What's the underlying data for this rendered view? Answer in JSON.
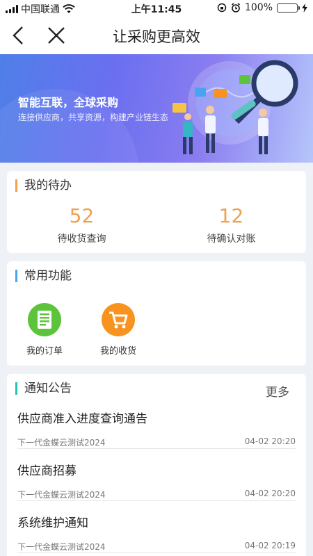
{
  "status": {
    "carrier": "中国联通",
    "time": "上午11:45",
    "battery": "100%"
  },
  "nav": {
    "title": "让采购更高效"
  },
  "banner": {
    "title": "智能互联，全球采购",
    "subtitle": "连接供应商，共享资源，构建产业链生态"
  },
  "todo": {
    "title": "我的待办",
    "items": [
      {
        "count": "52",
        "label": "待收货查询"
      },
      {
        "count": "12",
        "label": "待确认对账"
      }
    ]
  },
  "functions": {
    "title": "常用功能",
    "items": [
      {
        "label": "我的订单",
        "icon": "order-icon",
        "color": "#5cc33a"
      },
      {
        "label": "我的收货",
        "icon": "cart-icon",
        "color": "#f7931e"
      }
    ]
  },
  "notices": {
    "title": "通知公告",
    "more": "更多",
    "items": [
      {
        "title": "供应商准入进度查询通告",
        "source": "下一代金蝶云测试2024",
        "time": "04-02 20:20"
      },
      {
        "title": "供应商招募",
        "source": "下一代金蝶云测试2024",
        "time": "04-02 20:20"
      },
      {
        "title": "系统维护通知",
        "source": "下一代金蝶云测试2024",
        "time": "04-02 20:19"
      }
    ]
  }
}
